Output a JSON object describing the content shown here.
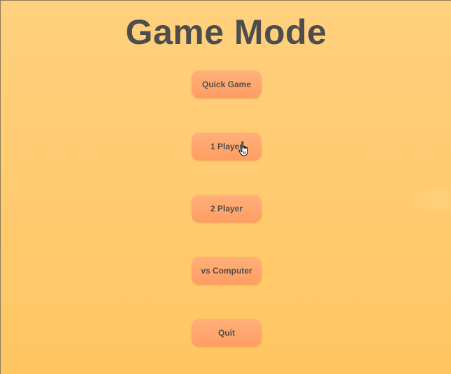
{
  "title": "Game Mode",
  "menu": {
    "items": [
      {
        "label": "Quick Game"
      },
      {
        "label": "1 Player"
      },
      {
        "label": "2 Player"
      },
      {
        "label": "vs Computer"
      },
      {
        "label": "Quit"
      }
    ]
  },
  "colors": {
    "background_top": "#ffd07e",
    "background_bottom": "#ffc662",
    "button_top": "#ffb07a",
    "button_bottom": "#ff9d63",
    "text": "#4d4d4d"
  },
  "cursor": {
    "icon": "hand-pointer-icon"
  }
}
